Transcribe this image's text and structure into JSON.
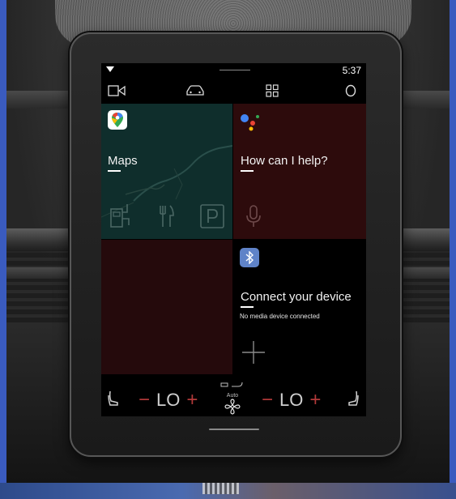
{
  "status_bar": {
    "time": "5:37"
  },
  "tiles": {
    "maps": {
      "title": "Maps",
      "bg": "#0f2e2c"
    },
    "assistant": {
      "title": "How can I help?",
      "bg": "#2d0b0c"
    },
    "connect": {
      "title": "Connect your device",
      "subtitle": "No media device connected"
    }
  },
  "climate": {
    "driver_temp": "LO",
    "passenger_temp": "LO",
    "minus": "−",
    "plus": "+",
    "fan_mode": "Auto",
    "accent": "#b33a3a"
  },
  "icons": [
    "wifi-icon",
    "camera-icon",
    "car-icon",
    "apps-grid-icon",
    "profile-circle-icon",
    "google-maps-icon",
    "google-assistant-icon",
    "ev-charger-icon",
    "restaurant-icon",
    "parking-icon",
    "microphone-icon",
    "bluetooth-icon",
    "add-icon",
    "seat-heat-icon",
    "fan-icon",
    "recirculate-icon",
    "defrost-icon"
  ]
}
